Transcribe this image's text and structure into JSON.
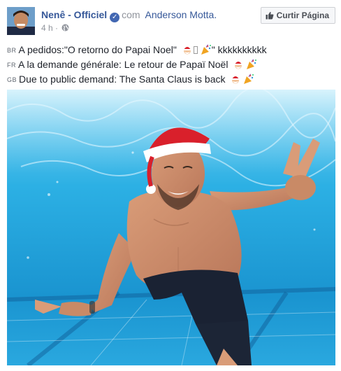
{
  "post": {
    "author": "Nenê - Officiel",
    "with_text": "com",
    "tagged_person": "Anderson Motta.",
    "time": "4 h",
    "separator": "·",
    "like_page_button": "Curtir Página",
    "lines": [
      {
        "lang": "BR",
        "before": "A pedidos:\"O retorno do Papai Noel\" ",
        "after": "\" kkkkkkkkkk",
        "has_box": true
      },
      {
        "lang": "FR",
        "before": "A la demande générale: Le retour de Papaï Noël ",
        "after": "",
        "has_box": false
      },
      {
        "lang": "GB",
        "before": "Due to public demand: The Santa Claus is back ",
        "after": "",
        "has_box": false
      }
    ],
    "icons": {
      "verified": "verified-badge-icon",
      "audience": "globe-icon",
      "like": "thumbs-up-icon",
      "emoji_1": "santa-emoji",
      "emoji_2": "party-popper-emoji"
    },
    "colors": {
      "link": "#365899",
      "meta": "#90949c",
      "verified": "#4267b2",
      "pool_water": "#2aa8df",
      "santa_hat": "#d9202b"
    }
  }
}
